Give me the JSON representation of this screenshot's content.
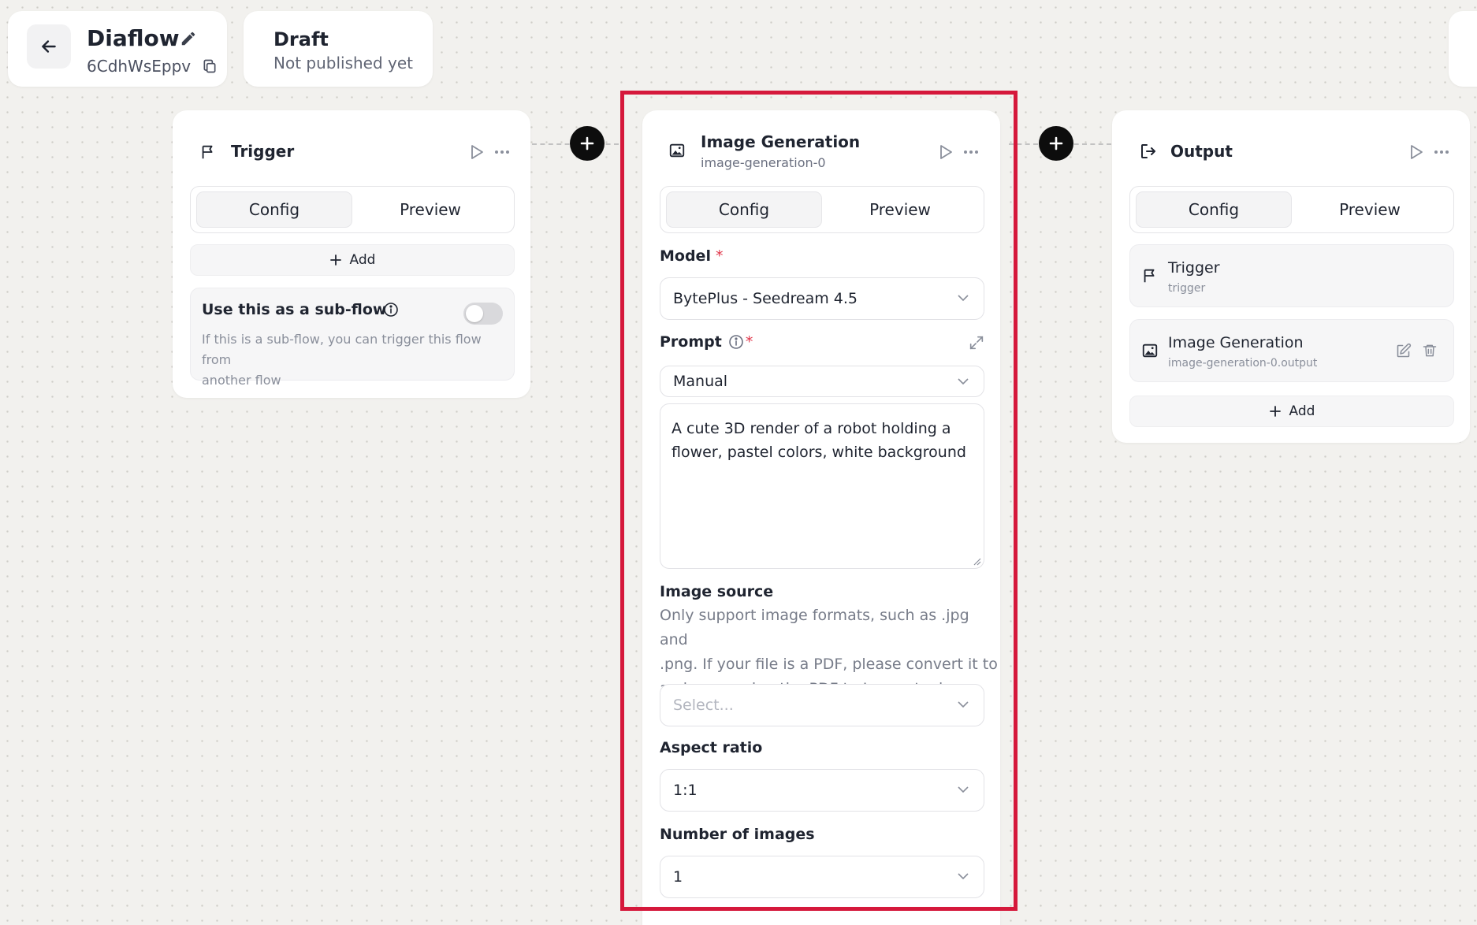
{
  "header": {
    "flow_title": "Diaflow",
    "flow_id": "6CdhWsEppv",
    "status_title": "Draft",
    "status_sub": "Not published yet"
  },
  "trigger_node": {
    "title": "Trigger",
    "tabs": [
      "Config",
      "Preview"
    ],
    "add_label": "Add",
    "subflow_title": "Use this as a sub-flow",
    "subflow_desc_1": "If this is a sub-flow, you can trigger this flow from",
    "subflow_desc_2": "another flow",
    "subflow_enabled": false
  },
  "image_node": {
    "title": "Image Generation",
    "subtitle": "image-generation-0",
    "tabs": [
      "Config",
      "Preview"
    ],
    "model_label": "Model",
    "model_value": "BytePlus - Seedream 4.5",
    "prompt_label": "Prompt",
    "prompt_mode": "Manual",
    "prompt_line_1": "A cute 3D render of a robot holding a",
    "prompt_line_2": "flower, pastel colors, white background",
    "image_source_label": "Image source",
    "image_source_help_1": "Only support image formats, such as .jpg and",
    "image_source_help_2": ".png. If your file is a PDF, please convert it to",
    "image_source_help_3": "an image using the PDF to Image tool.",
    "image_source_placeholder": "Select...",
    "aspect_label": "Aspect ratio",
    "aspect_value": "1:1",
    "count_label": "Number of images",
    "count_value": "1",
    "required_mark": "*"
  },
  "output_node": {
    "title": "Output",
    "tabs": [
      "Config",
      "Preview"
    ],
    "items": [
      {
        "title": "Trigger",
        "sub": "trigger"
      },
      {
        "title": "Image Generation",
        "sub": "image-generation-0.output"
      }
    ],
    "add_label": "Add"
  },
  "colors": {
    "highlight": "#d5183b",
    "required": "#e0364a",
    "canvas": "#f2f1ee"
  }
}
